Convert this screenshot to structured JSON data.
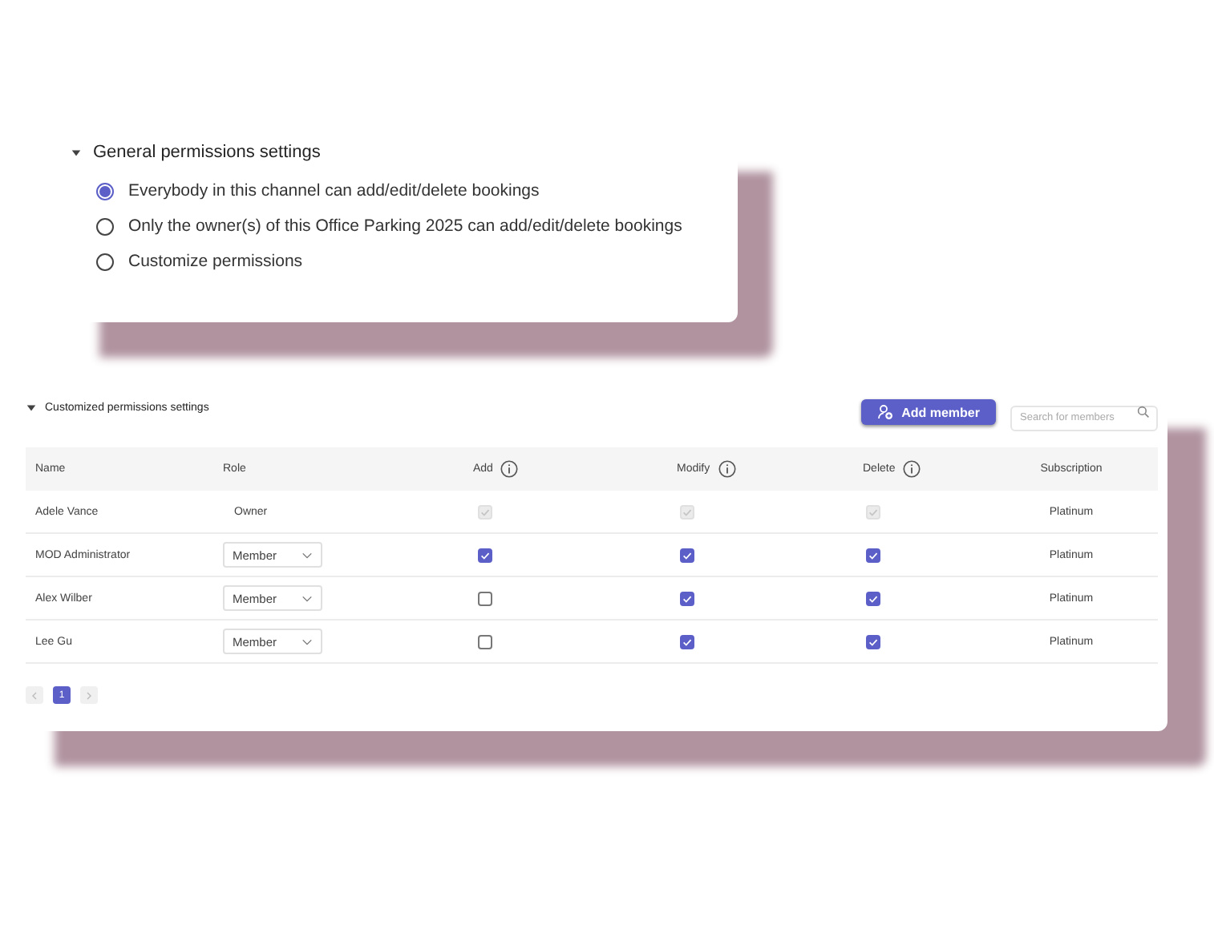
{
  "general": {
    "title": "General permissions settings",
    "expanded": true,
    "options": [
      {
        "label": "Everybody in this channel can add/edit/delete bookings",
        "selected": true
      },
      {
        "label": "Only the owner(s) of this Office Parking 2025 can add/edit/delete bookings",
        "selected": false
      },
      {
        "label": "Customize permissions",
        "selected": false
      }
    ]
  },
  "custom": {
    "title": "Customized permissions settings",
    "expanded": true,
    "add_button": "Add member",
    "search": {
      "placeholder": "Search for members"
    },
    "columns": [
      {
        "label": "Name",
        "info": false
      },
      {
        "label": "Role",
        "info": false
      },
      {
        "label": "Add",
        "info": true
      },
      {
        "label": "Modify",
        "info": true
      },
      {
        "label": "Delete",
        "info": true
      },
      {
        "label": "Subscription",
        "info": false
      }
    ],
    "rows": [
      {
        "name": "Adele Vance",
        "role": {
          "kind": "text",
          "value": "Owner"
        },
        "add": {
          "checked": true,
          "disabled": true
        },
        "modify": {
          "checked": true,
          "disabled": true
        },
        "delete": {
          "checked": true,
          "disabled": true
        },
        "subscription": "Platinum"
      },
      {
        "name": "MOD Administrator",
        "role": {
          "kind": "dropdown",
          "value": "Member"
        },
        "add": {
          "checked": true,
          "disabled": false
        },
        "modify": {
          "checked": true,
          "disabled": false
        },
        "delete": {
          "checked": true,
          "disabled": false
        },
        "subscription": "Platinum"
      },
      {
        "name": "Alex Wilber",
        "role": {
          "kind": "dropdown",
          "value": "Member"
        },
        "add": {
          "checked": false,
          "disabled": false
        },
        "modify": {
          "checked": true,
          "disabled": false
        },
        "delete": {
          "checked": true,
          "disabled": false
        },
        "subscription": "Platinum"
      },
      {
        "name": "Lee Gu",
        "role": {
          "kind": "dropdown",
          "value": "Member"
        },
        "add": {
          "checked": false,
          "disabled": false
        },
        "modify": {
          "checked": true,
          "disabled": false
        },
        "delete": {
          "checked": true,
          "disabled": false
        },
        "subscription": "Platinum"
      }
    ],
    "pagination": {
      "pages": [
        {
          "label": "1",
          "selected": true
        }
      ]
    }
  }
}
